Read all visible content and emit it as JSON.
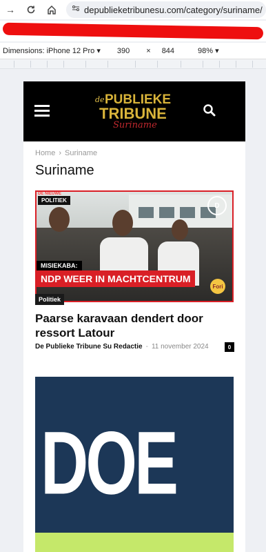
{
  "browser": {
    "url": "depublieketribunesu.com/category/suriname/",
    "device_label": "Dimensions: iPhone 12 Pro",
    "width": "390",
    "times": "×",
    "height": "844",
    "zoom": "98%"
  },
  "site": {
    "logo_de": "de",
    "logo_publieke": "PUBLIEKE",
    "logo_tribune": "TRIBUNE",
    "logo_suriname": "Suriname"
  },
  "breadcrumb": {
    "home": "Home",
    "separator": "›",
    "current": "Suriname"
  },
  "page_title": "Suriname",
  "article": {
    "image_tag": "POLITIEK",
    "image_subtag": "DE NIEUWE",
    "image_logo": "D",
    "strip_text": "MISIEKABA:",
    "headline_overlay": "NDP WEER IN MACHTCENTRUM",
    "fori_badge": "Fori",
    "category": "Politiek",
    "title": "Paarse karavaan dendert door ressort Latour",
    "author": "De Publieke Tribune Su Redactie",
    "separator": "-",
    "date": "11 november 2024",
    "comments": "0"
  },
  "card2": {
    "big_text": "DOE"
  }
}
